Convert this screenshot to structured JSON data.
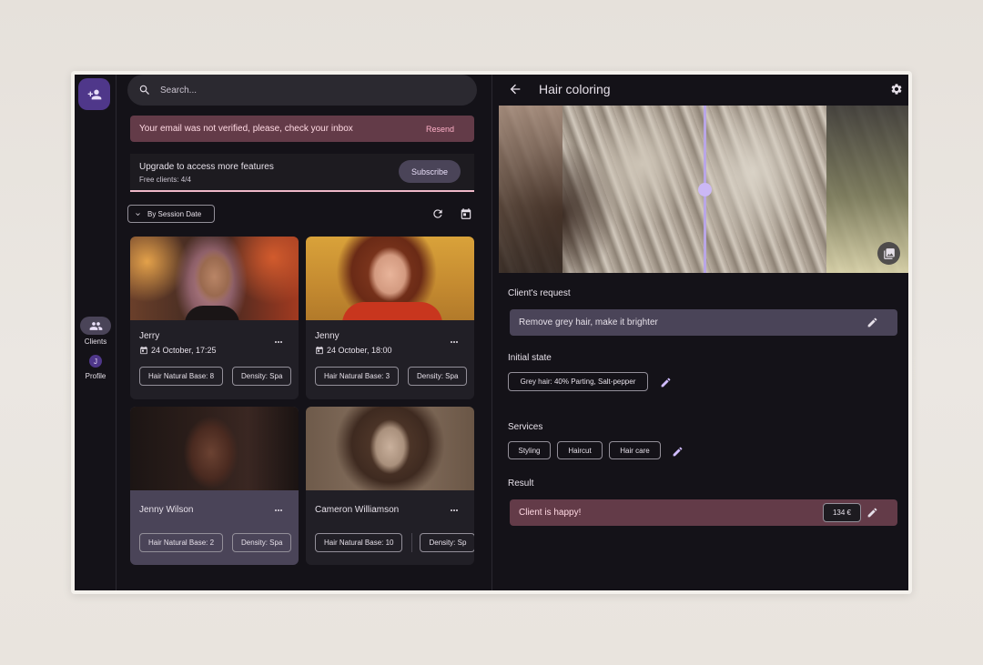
{
  "rail": {
    "add_client_icon": "person-add-icon",
    "items": [
      {
        "label": "Clients",
        "icon": "people-icon",
        "active": true
      },
      {
        "label": "Profile",
        "avatar_letter": "J",
        "active": false
      }
    ]
  },
  "search": {
    "placeholder": "Search...",
    "icon": "search-icon"
  },
  "banner": {
    "message": "Your email was not verified, please, check your inbox",
    "action": "Resend"
  },
  "upgrade": {
    "title": "Upgrade to access more features",
    "subtitle": "Free clients: 4/4",
    "button": "Subscribe"
  },
  "sort": {
    "label": "By Session Date"
  },
  "clients": [
    {
      "name": "Jerry",
      "date": "24 October, 17:25",
      "chips": [
        "Hair Natural Base: 8",
        "Density: Spa"
      ],
      "selected": false
    },
    {
      "name": "Jenny",
      "date": "24 October, 18:00",
      "chips": [
        "Hair Natural Base: 3",
        "Density: Spa"
      ],
      "selected": false
    },
    {
      "name": "Jenny Wilson",
      "date": "",
      "chips": [
        "Hair Natural Base: 2",
        "Density: Spa"
      ],
      "selected": true
    },
    {
      "name": "Cameron Williamson",
      "date": "",
      "chips": [
        "Hair Natural Base: 10",
        "Density: Sp"
      ],
      "selected": false
    }
  ],
  "detail": {
    "title": "Hair coloring",
    "request_label": "Client's request",
    "request_text": "Remove grey hair, make it brighter",
    "initial_label": "Initial state",
    "initial_chip": "Grey hair: 40% Parting, Salt-pepper",
    "services_label": "Services",
    "services": [
      "Styling",
      "Haircut",
      "Hair care"
    ],
    "result_label": "Result",
    "result_text": "Client is happy!",
    "price": "134 €"
  },
  "colors": {
    "background": "#141218",
    "surface": "#211f26",
    "primary_container": "#4f378a",
    "banner": "#633b48",
    "accent": "#d0bcff"
  }
}
